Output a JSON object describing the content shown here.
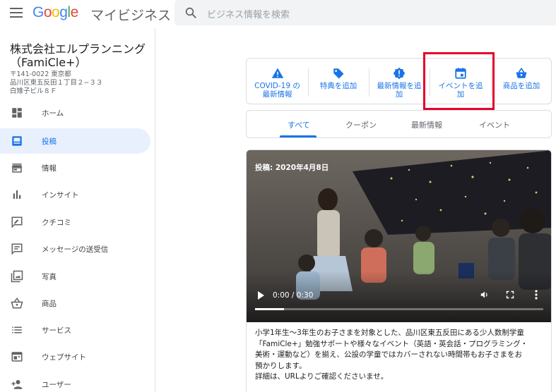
{
  "header": {
    "logo": "Google",
    "product": "マイビジネス",
    "search_placeholder": "ビジネス情報を検索"
  },
  "business": {
    "name": "株式会社エルプランニング（FamiCle+）",
    "address_lines": [
      "〒141-0022 東京都",
      "品川区東五反田１丁目２−３３",
      "白雉子ビル８Ｆ"
    ]
  },
  "nav": [
    {
      "label": "ホーム",
      "icon": "dashboard-icon"
    },
    {
      "label": "投稿",
      "icon": "posts-icon",
      "active": true
    },
    {
      "label": "情報",
      "icon": "storefront-icon"
    },
    {
      "label": "インサイト",
      "icon": "bar-chart-icon"
    },
    {
      "label": "クチコミ",
      "icon": "review-icon"
    },
    {
      "label": "メッセージの送受信",
      "icon": "message-icon"
    },
    {
      "label": "写真",
      "icon": "photo-icon"
    },
    {
      "label": "商品",
      "icon": "basket-icon"
    },
    {
      "label": "サービス",
      "icon": "list-icon"
    },
    {
      "label": "ウェブサイト",
      "icon": "web-icon"
    },
    {
      "label": "ユーザー",
      "icon": "add-person-icon"
    }
  ],
  "actions": [
    {
      "line1": "COVID-19 の",
      "line2": "最新情報",
      "icon": "warning-icon"
    },
    {
      "line1": "特典を追加",
      "line2": "",
      "icon": "tag-icon"
    },
    {
      "line1": "最新情報を追",
      "line2": "加",
      "icon": "badge-icon"
    },
    {
      "line1": "イベントを追",
      "line2": "加",
      "icon": "calendar-icon"
    },
    {
      "line1": "商品を追加",
      "line2": "",
      "icon": "basket-icon"
    }
  ],
  "tabs": [
    "すべて",
    "クーポン",
    "最新情報",
    "イベント"
  ],
  "active_tab": "すべて",
  "post": {
    "date_label": "投稿: 2020年4月8日",
    "video_time": "0:00 / 0:30",
    "progress": 0.1,
    "body_lines": [
      "小学1年生～3年生のお子さまを対象とした、品川区東五反田にある少人数制学童",
      "「FamiCle+」勉強サポートや様々なイベント（英語・英会話・プログラミング・",
      "美術・運動など）を揃え、公設の学童ではカバーされない時間帯もお子さまをお",
      "預かりします。",
      "詳細は、URLよりご確認くださいませ。"
    ]
  },
  "colors": {
    "accent": "#1a73e8",
    "highlight": "#e4002b",
    "active_nav_bg": "#e8f0fe"
  }
}
